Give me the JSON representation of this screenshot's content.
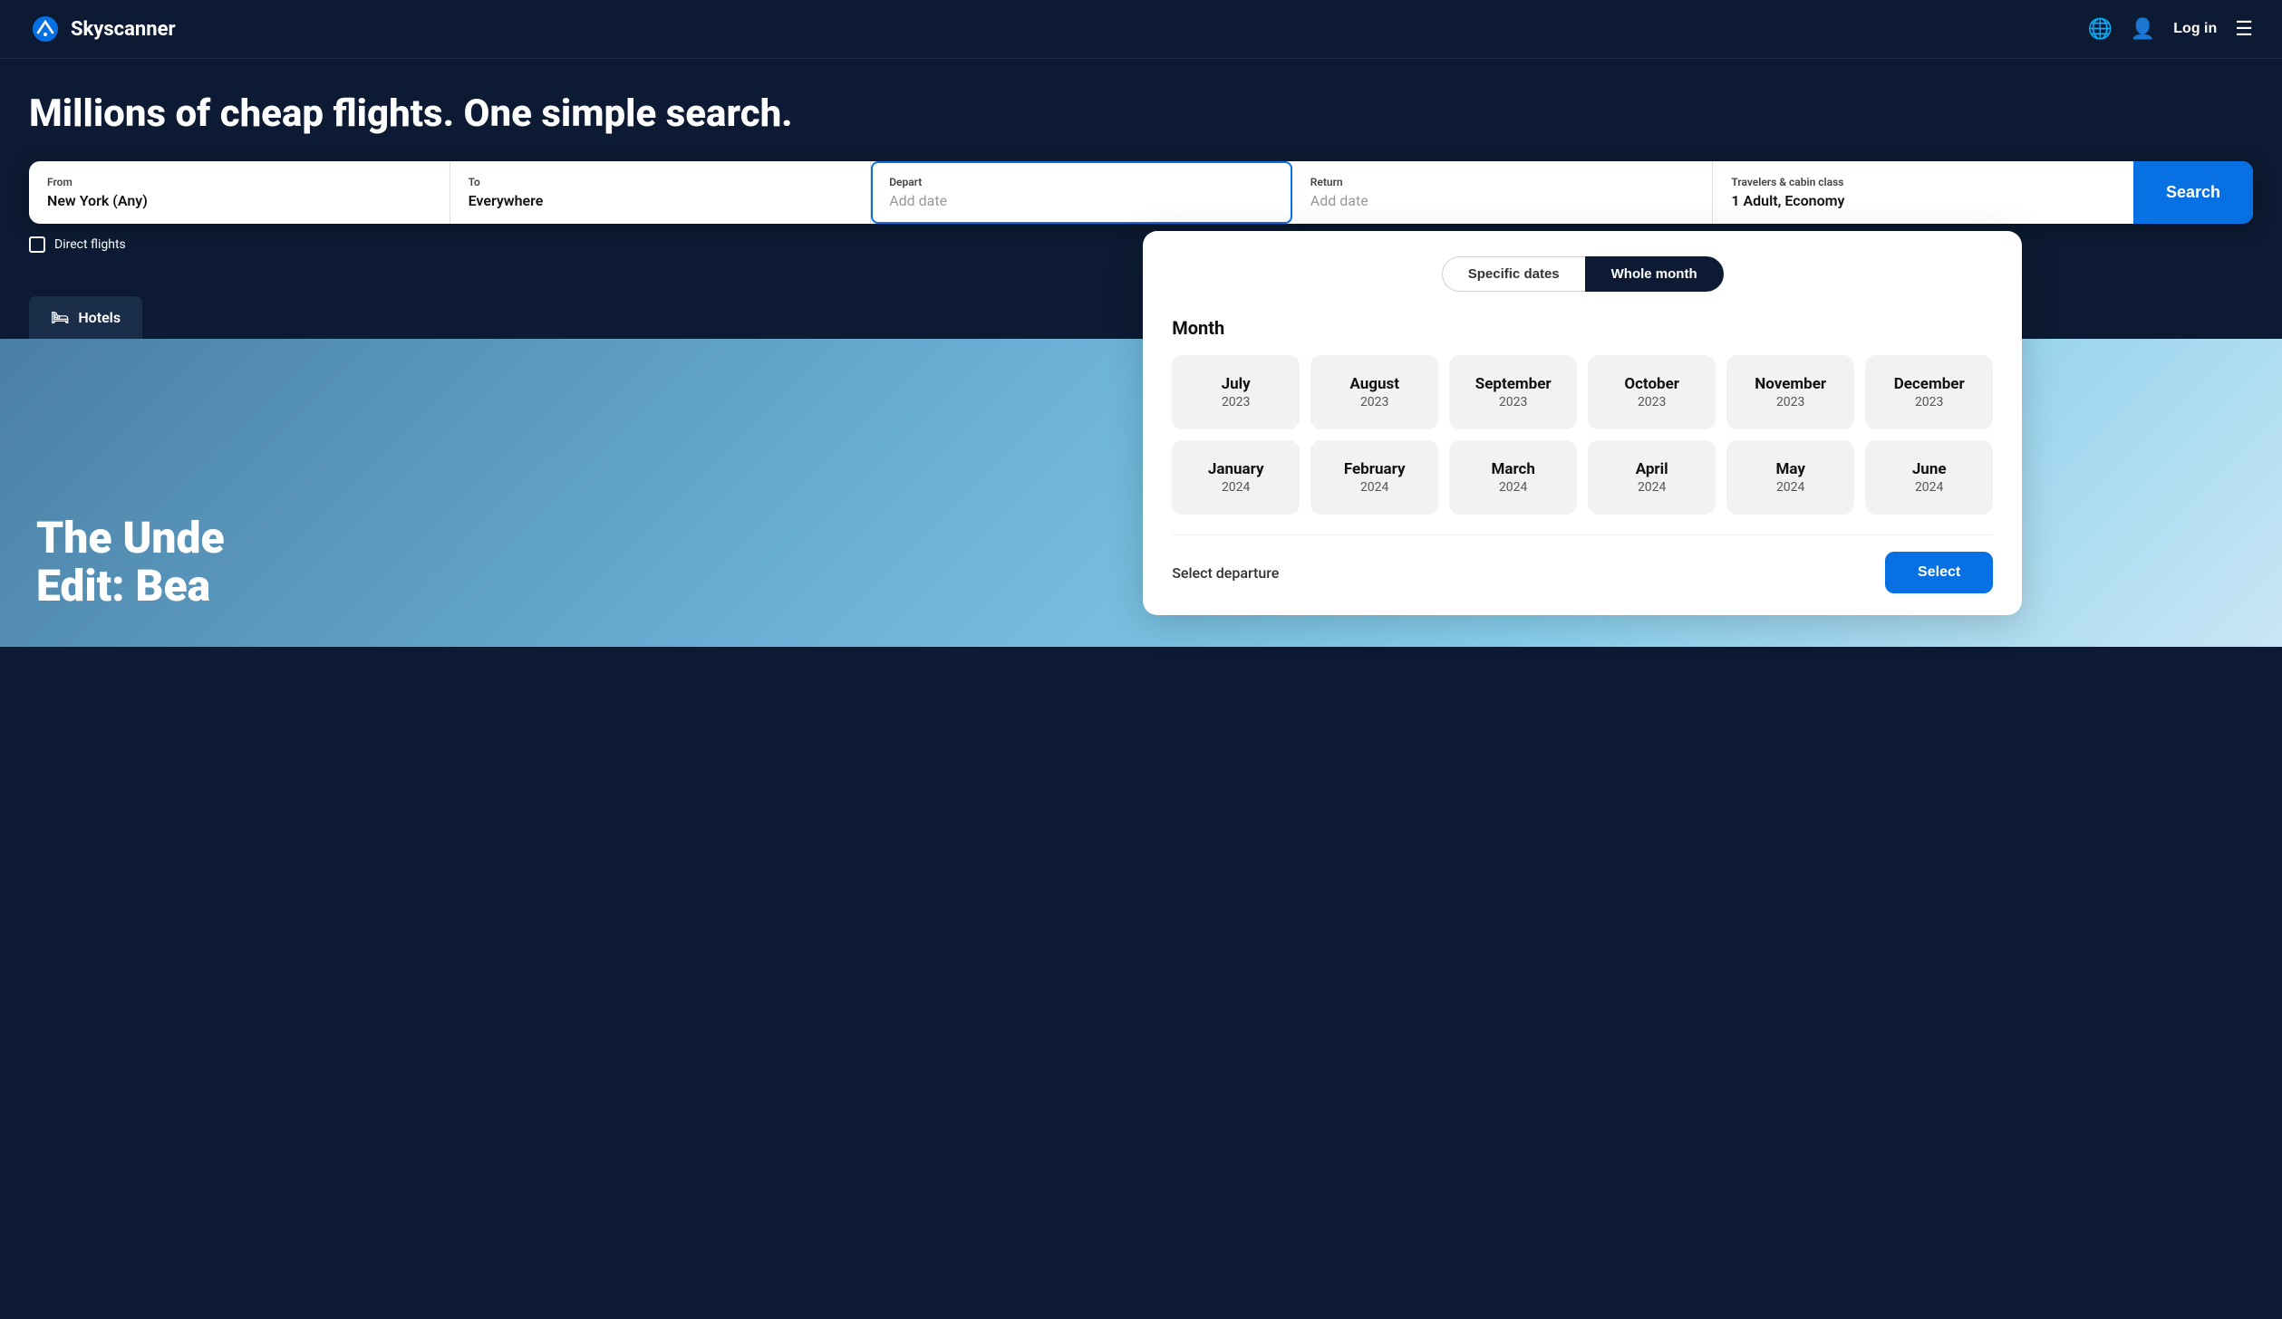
{
  "header": {
    "logo_text": "Skyscanner",
    "login_label": "Log in"
  },
  "hero": {
    "title": "Millions of cheap flights. One simple search."
  },
  "search": {
    "from_label": "From",
    "from_value": "New York (Any)",
    "to_label": "To",
    "to_value": "Everywhere",
    "depart_label": "Depart",
    "depart_placeholder": "Add date",
    "return_label": "Return",
    "return_placeholder": "Add date",
    "travelers_label": "Travelers & cabin class",
    "travelers_value": "1 Adult, Economy",
    "search_button": "Search"
  },
  "direct_flights": {
    "label": "Direct flights"
  },
  "tabs": {
    "hotels_label": "Hotels"
  },
  "date_picker": {
    "specific_dates_label": "Specific dates",
    "whole_month_label": "Whole month",
    "month_section_title": "Month",
    "months_row1": [
      {
        "name": "July",
        "year": "2023"
      },
      {
        "name": "August",
        "year": "2023"
      },
      {
        "name": "September",
        "year": "2023"
      },
      {
        "name": "October",
        "year": "2023"
      },
      {
        "name": "November",
        "year": "2023"
      },
      {
        "name": "December",
        "year": "2023"
      }
    ],
    "months_row2": [
      {
        "name": "January",
        "year": "2024"
      },
      {
        "name": "February",
        "year": "2024"
      },
      {
        "name": "March",
        "year": "2024"
      },
      {
        "name": "April",
        "year": "2024"
      },
      {
        "name": "May",
        "year": "2024"
      },
      {
        "name": "June",
        "year": "2024"
      }
    ],
    "footer_text": "Select departure",
    "select_button": "Select"
  },
  "hero_image": {
    "text_line1": "The Unde",
    "text_line2": "Edit: Bea"
  }
}
